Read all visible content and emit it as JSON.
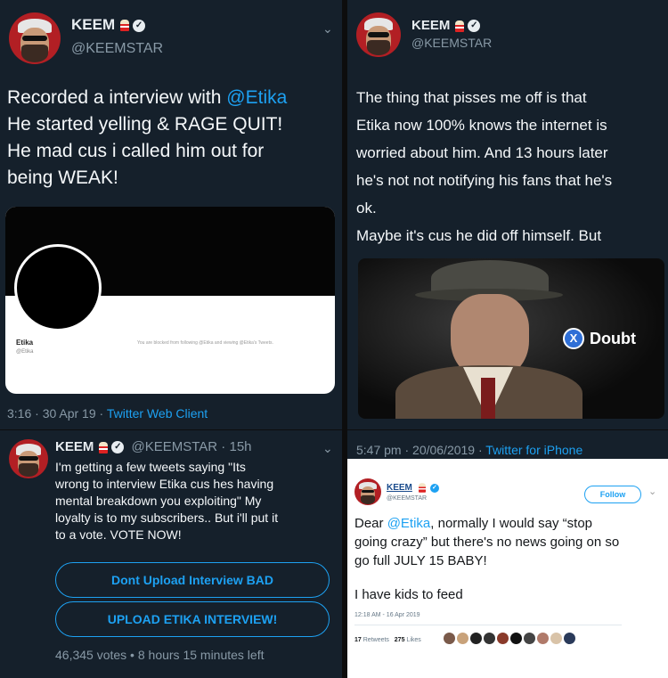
{
  "tl": {
    "name": "KEEM",
    "handle": "@KEEMSTAR",
    "text_pre": "Recorded a interview with ",
    "mention": "@Etika",
    "text_post": "\nHe started yelling & RAGE QUIT!\nHe mad cus i called him out for\nbeing WEAK!",
    "embed": {
      "name": "Etika",
      "handle": "@Etika",
      "blocked_text": "You are blocked from following @Etika and viewing @Etika's Tweets."
    },
    "meta": "3:16 · 30 Apr 19 · ",
    "app": "Twitter Web Client"
  },
  "tr": {
    "name": "KEEM",
    "handle": "@KEEMSTAR",
    "text1": "The thing that pisses me off is that\nEtika now 100% knows the internet is\nworried about him. And 13 hours later\nhe's not not notifying his fans that he's\nok.",
    "text2": "Maybe it's cus he did off himself. But",
    "doubt_x": "X",
    "doubt_label": "Doubt",
    "meta": "5:47 pm · 20/06/2019 · ",
    "app": "Twitter for iPhone"
  },
  "bl": {
    "name": "KEEM",
    "handle": "@KEEMSTAR · 15h",
    "text": "I'm getting a few tweets saying \"Its\nwrong to interview Etika cus hes having\nmental breakdown you exploiting\" My\nloyalty is to my subscribers.. But i'll put it\nto a vote. VOTE NOW!",
    "option1": "Dont Upload Interview BAD",
    "option2": "UPLOAD ETIKA INTERVIEW!",
    "votes": "46,345 votes • 8 hours 15 minutes left"
  },
  "br": {
    "name": "KEEM",
    "handle": "@KEEMSTAR",
    "follow": "Follow",
    "text_pre": "Dear ",
    "mention": "@Etika",
    "text_post": ", normally I would say “stop\ngoing crazy” but there's no news going on so\ngo full JULY 15 BABY!",
    "text2": "I have kids to feed",
    "timestamp": "12:18 AM - 16 Apr 2019",
    "retweets_count": "17",
    "retweets_label": "Retweets",
    "likes_count": "275",
    "likes_label": "Likes"
  },
  "colors": {
    "dark_bg": "#15202b",
    "twitter_blue": "#1da1f2",
    "gray": "#8899a6"
  }
}
